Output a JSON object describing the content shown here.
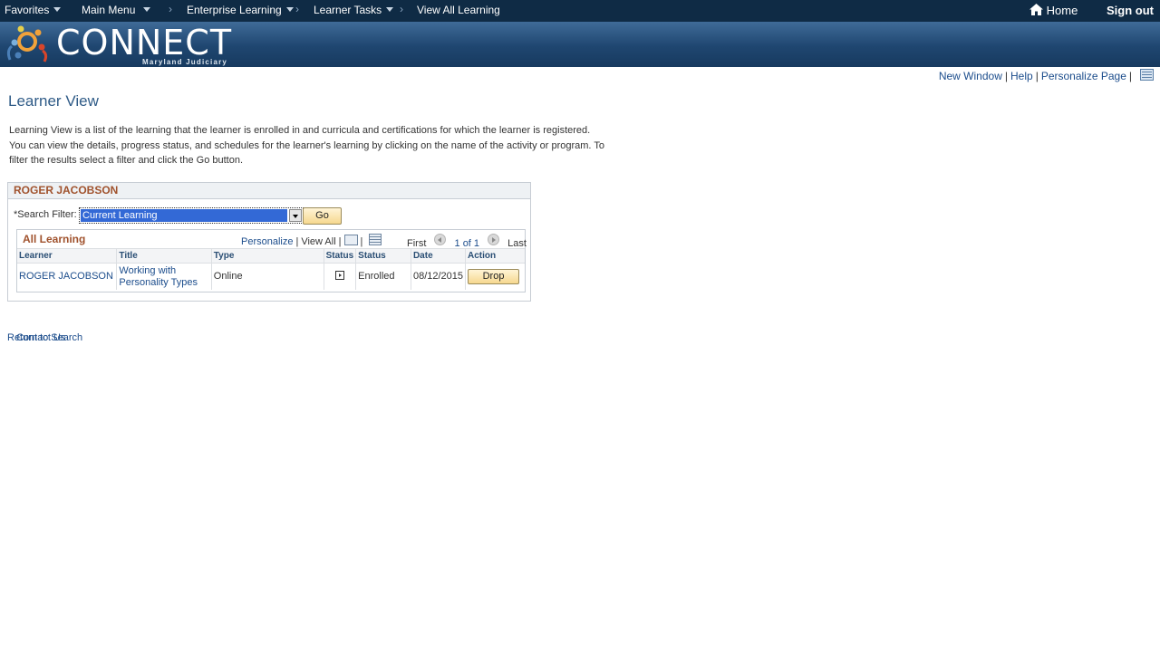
{
  "topbar": {
    "favorites": "Favorites",
    "main_menu": "Main Menu",
    "enterprise_learning": "Enterprise Learning",
    "learner_tasks": "Learner Tasks",
    "current": "View All Learning",
    "home": "Home",
    "signout": "Sign out",
    "separator": "›"
  },
  "banner": {
    "logo_text": "CONNECT",
    "logo_sub": "Maryland Judiciary"
  },
  "util_links": {
    "new_window": "New Window",
    "help": "Help",
    "personalize_page": "Personalize Page",
    "pipe": "|"
  },
  "page": {
    "title": "Learner View",
    "description": "Learning View is a list of the learning that the learner is enrolled in and curricula and certifications for which the learner is registered. You can view the details, progress status, and schedules for the learner's learning by clicking on the name of the activity or program. To filter the results select a filter and click the Go button."
  },
  "learner_box": {
    "name": "ROGER JACOBSON",
    "filter_label": "*Search Filter:",
    "filter_value": "Current Learning",
    "go_label": "Go"
  },
  "grid": {
    "title": "All Learning",
    "personalize": "Personalize",
    "view_all": "View All",
    "first": "First",
    "range": "1 of 1",
    "last": "Last",
    "columns": [
      "Learner",
      "Title",
      "Type",
      "Status",
      "Status",
      "Date",
      "Action"
    ],
    "rows": [
      {
        "learner": "ROGER JACOBSON",
        "title": "Working with Personality Types",
        "type": "Online",
        "status": "Enrolled",
        "date": "08/12/2015",
        "action": "Drop"
      }
    ]
  },
  "footer_links": {
    "return": "Return to Search",
    "contact": "Contact Us"
  }
}
